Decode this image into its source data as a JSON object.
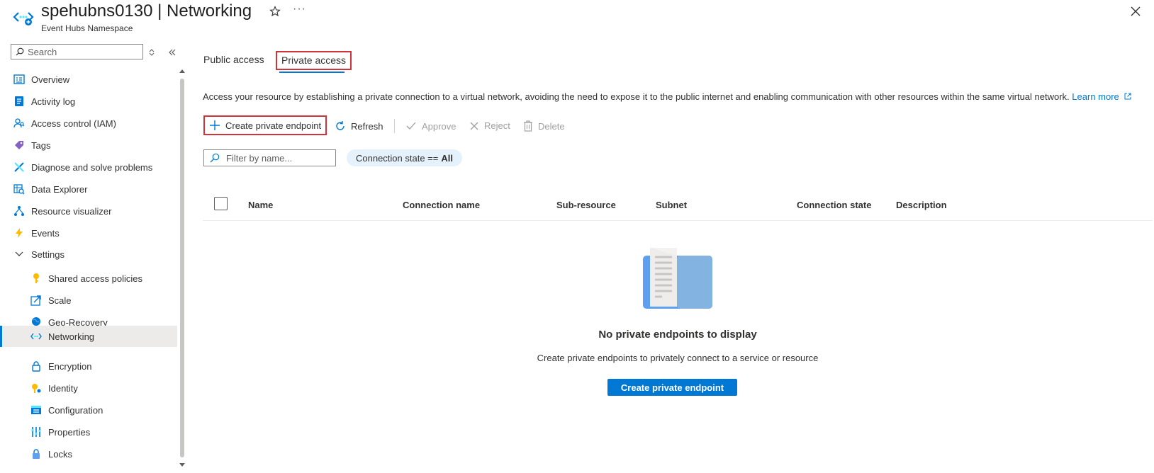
{
  "header": {
    "title": "spehubns0130 | Networking",
    "subtitle": "Event Hubs Namespace"
  },
  "sidebar": {
    "search_placeholder": "Search",
    "items": [
      {
        "label": "Overview",
        "icon": "overview-icon"
      },
      {
        "label": "Activity log",
        "icon": "activity-log-icon"
      },
      {
        "label": "Access control (IAM)",
        "icon": "iam-icon"
      },
      {
        "label": "Tags",
        "icon": "tag-icon"
      },
      {
        "label": "Diagnose and solve problems",
        "icon": "wrench-icon"
      },
      {
        "label": "Data Explorer",
        "icon": "data-explorer-icon"
      },
      {
        "label": "Resource visualizer",
        "icon": "resource-visualizer-icon"
      },
      {
        "label": "Events",
        "icon": "lightning-icon"
      },
      {
        "label": "Settings",
        "icon": "chevron-down-icon"
      },
      {
        "label": "Shared access policies",
        "icon": "key-icon"
      },
      {
        "label": "Scale",
        "icon": "scale-icon"
      },
      {
        "label": "Geo-Recovery",
        "icon": "globe-icon"
      },
      {
        "label": "Networking",
        "icon": "networking-icon"
      },
      {
        "label": "Encryption",
        "icon": "lock-icon"
      },
      {
        "label": "Identity",
        "icon": "identity-icon"
      },
      {
        "label": "Configuration",
        "icon": "configuration-icon"
      },
      {
        "label": "Properties",
        "icon": "properties-icon"
      },
      {
        "label": "Locks",
        "icon": "locks-icon"
      }
    ]
  },
  "main": {
    "tabs": [
      {
        "label": "Public access"
      },
      {
        "label": "Private access"
      }
    ],
    "description": "Access your resource by establishing a private connection to a virtual network, avoiding the need to expose it to the public internet and enabling communication with other resources within the same virtual network.",
    "learn_more": "Learn more",
    "toolbar": {
      "create": "Create private endpoint",
      "refresh": "Refresh",
      "approve": "Approve",
      "reject": "Reject",
      "delete": "Delete"
    },
    "filter_placeholder": "Filter by name...",
    "pill": {
      "prefix": "Connection state ==",
      "value": "All"
    },
    "table": {
      "columns": [
        "Name",
        "Connection name",
        "Sub-resource",
        "Subnet",
        "Connection state",
        "Description"
      ]
    },
    "empty": {
      "title": "No private endpoints to display",
      "description": "Create private endpoints to privately connect to a service or resource",
      "button": "Create private endpoint"
    }
  },
  "colors": {
    "accent": "#0078d4",
    "highlight": "#d13438",
    "selected_bg": "#edebe9",
    "pill_bg": "#e5f1fb"
  }
}
